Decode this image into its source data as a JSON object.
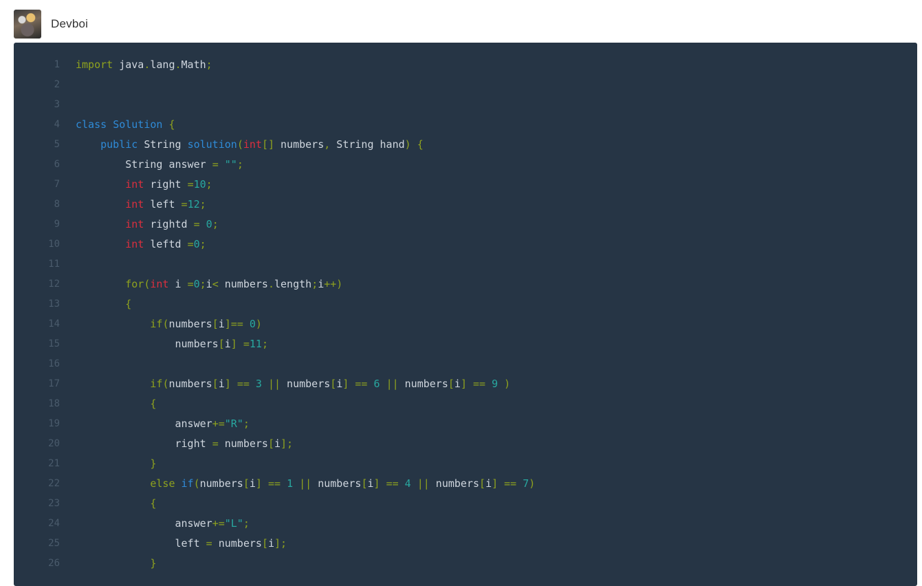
{
  "post": {
    "author": "Devboi"
  },
  "code": {
    "lines": [
      {
        "n": "1",
        "tokens": [
          [
            "kw",
            "import"
          ],
          [
            "id",
            " java"
          ],
          [
            "punc",
            "."
          ],
          [
            "id",
            "lang"
          ],
          [
            "punc",
            "."
          ],
          [
            "id",
            "Math"
          ],
          [
            "punc",
            ";"
          ]
        ]
      },
      {
        "n": "2",
        "tokens": []
      },
      {
        "n": "3",
        "tokens": []
      },
      {
        "n": "4",
        "tokens": [
          [
            "blue",
            "class"
          ],
          [
            "id",
            " "
          ],
          [
            "blue",
            "Solution"
          ],
          [
            "id",
            " "
          ],
          [
            "punc",
            "{"
          ]
        ]
      },
      {
        "n": "5",
        "tokens": [
          [
            "id",
            "    "
          ],
          [
            "blue",
            "public"
          ],
          [
            "id",
            " String "
          ],
          [
            "blue",
            "solution"
          ],
          [
            "punc",
            "("
          ],
          [
            "int",
            "int"
          ],
          [
            "punc",
            "[]"
          ],
          [
            "id",
            " numbers"
          ],
          [
            "punc",
            ","
          ],
          [
            "id",
            " String hand"
          ],
          [
            "punc",
            ")"
          ],
          [
            "id",
            " "
          ],
          [
            "punc",
            "{"
          ]
        ]
      },
      {
        "n": "6",
        "tokens": [
          [
            "id",
            "        String answer "
          ],
          [
            "punc",
            "="
          ],
          [
            "id",
            " "
          ],
          [
            "str",
            "\"\""
          ],
          [
            "punc",
            ";"
          ]
        ]
      },
      {
        "n": "7",
        "tokens": [
          [
            "id",
            "        "
          ],
          [
            "int",
            "int"
          ],
          [
            "id",
            " right "
          ],
          [
            "punc",
            "="
          ],
          [
            "num",
            "10"
          ],
          [
            "punc",
            ";"
          ]
        ]
      },
      {
        "n": "8",
        "tokens": [
          [
            "id",
            "        "
          ],
          [
            "int",
            "int"
          ],
          [
            "id",
            " left "
          ],
          [
            "punc",
            "="
          ],
          [
            "num",
            "12"
          ],
          [
            "punc",
            ";"
          ]
        ]
      },
      {
        "n": "9",
        "tokens": [
          [
            "id",
            "        "
          ],
          [
            "int",
            "int"
          ],
          [
            "id",
            " rightd "
          ],
          [
            "punc",
            "="
          ],
          [
            "id",
            " "
          ],
          [
            "num",
            "0"
          ],
          [
            "punc",
            ";"
          ]
        ]
      },
      {
        "n": "10",
        "tokens": [
          [
            "id",
            "        "
          ],
          [
            "int",
            "int"
          ],
          [
            "id",
            " leftd "
          ],
          [
            "punc",
            "="
          ],
          [
            "num",
            "0"
          ],
          [
            "punc",
            ";"
          ]
        ]
      },
      {
        "n": "11",
        "tokens": []
      },
      {
        "n": "12",
        "tokens": [
          [
            "id",
            "        "
          ],
          [
            "kw",
            "for"
          ],
          [
            "punc",
            "("
          ],
          [
            "int",
            "int"
          ],
          [
            "id",
            " i "
          ],
          [
            "punc",
            "="
          ],
          [
            "num",
            "0"
          ],
          [
            "punc",
            ";"
          ],
          [
            "id",
            "i"
          ],
          [
            "punc",
            "<"
          ],
          [
            "id",
            " numbers"
          ],
          [
            "punc",
            "."
          ],
          [
            "id",
            "length"
          ],
          [
            "punc",
            ";"
          ],
          [
            "id",
            "i"
          ],
          [
            "punc",
            "++)"
          ]
        ]
      },
      {
        "n": "13",
        "tokens": [
          [
            "id",
            "        "
          ],
          [
            "punc",
            "{"
          ]
        ]
      },
      {
        "n": "14",
        "tokens": [
          [
            "id",
            "            "
          ],
          [
            "kw",
            "if"
          ],
          [
            "punc",
            "("
          ],
          [
            "id",
            "numbers"
          ],
          [
            "punc",
            "["
          ],
          [
            "id",
            "i"
          ],
          [
            "punc",
            "]=="
          ],
          [
            "id",
            " "
          ],
          [
            "num",
            "0"
          ],
          [
            "punc",
            ")"
          ]
        ]
      },
      {
        "n": "15",
        "tokens": [
          [
            "id",
            "                numbers"
          ],
          [
            "punc",
            "["
          ],
          [
            "id",
            "i"
          ],
          [
            "punc",
            "]"
          ],
          [
            "id",
            " "
          ],
          [
            "punc",
            "="
          ],
          [
            "num",
            "11"
          ],
          [
            "punc",
            ";"
          ]
        ]
      },
      {
        "n": "16",
        "tokens": []
      },
      {
        "n": "17",
        "tokens": [
          [
            "id",
            "            "
          ],
          [
            "kw",
            "if"
          ],
          [
            "punc",
            "("
          ],
          [
            "id",
            "numbers"
          ],
          [
            "punc",
            "["
          ],
          [
            "id",
            "i"
          ],
          [
            "punc",
            "]"
          ],
          [
            "id",
            " "
          ],
          [
            "punc",
            "=="
          ],
          [
            "id",
            " "
          ],
          [
            "num",
            "3"
          ],
          [
            "id",
            " "
          ],
          [
            "punc",
            "||"
          ],
          [
            "id",
            " numbers"
          ],
          [
            "punc",
            "["
          ],
          [
            "id",
            "i"
          ],
          [
            "punc",
            "]"
          ],
          [
            "id",
            " "
          ],
          [
            "punc",
            "=="
          ],
          [
            "id",
            " "
          ],
          [
            "num",
            "6"
          ],
          [
            "id",
            " "
          ],
          [
            "punc",
            "||"
          ],
          [
            "id",
            " numbers"
          ],
          [
            "punc",
            "["
          ],
          [
            "id",
            "i"
          ],
          [
            "punc",
            "]"
          ],
          [
            "id",
            " "
          ],
          [
            "punc",
            "=="
          ],
          [
            "id",
            " "
          ],
          [
            "num",
            "9"
          ],
          [
            "id",
            " "
          ],
          [
            "punc",
            ")"
          ]
        ]
      },
      {
        "n": "18",
        "tokens": [
          [
            "id",
            "            "
          ],
          [
            "punc",
            "{"
          ]
        ]
      },
      {
        "n": "19",
        "tokens": [
          [
            "id",
            "                answer"
          ],
          [
            "punc",
            "+="
          ],
          [
            "str",
            "\"R\""
          ],
          [
            "punc",
            ";"
          ]
        ]
      },
      {
        "n": "20",
        "tokens": [
          [
            "id",
            "                right "
          ],
          [
            "punc",
            "="
          ],
          [
            "id",
            " numbers"
          ],
          [
            "punc",
            "["
          ],
          [
            "id",
            "i"
          ],
          [
            "punc",
            "];"
          ]
        ]
      },
      {
        "n": "21",
        "tokens": [
          [
            "id",
            "            "
          ],
          [
            "punc",
            "}"
          ]
        ]
      },
      {
        "n": "22",
        "tokens": [
          [
            "id",
            "            "
          ],
          [
            "kw",
            "else"
          ],
          [
            "id",
            " "
          ],
          [
            "blue",
            "if"
          ],
          [
            "punc",
            "("
          ],
          [
            "id",
            "numbers"
          ],
          [
            "punc",
            "["
          ],
          [
            "id",
            "i"
          ],
          [
            "punc",
            "]"
          ],
          [
            "id",
            " "
          ],
          [
            "punc",
            "=="
          ],
          [
            "id",
            " "
          ],
          [
            "num",
            "1"
          ],
          [
            "id",
            " "
          ],
          [
            "punc",
            "||"
          ],
          [
            "id",
            " numbers"
          ],
          [
            "punc",
            "["
          ],
          [
            "id",
            "i"
          ],
          [
            "punc",
            "]"
          ],
          [
            "id",
            " "
          ],
          [
            "punc",
            "=="
          ],
          [
            "id",
            " "
          ],
          [
            "num",
            "4"
          ],
          [
            "id",
            " "
          ],
          [
            "punc",
            "||"
          ],
          [
            "id",
            " numbers"
          ],
          [
            "punc",
            "["
          ],
          [
            "id",
            "i"
          ],
          [
            "punc",
            "]"
          ],
          [
            "id",
            " "
          ],
          [
            "punc",
            "=="
          ],
          [
            "id",
            " "
          ],
          [
            "num",
            "7"
          ],
          [
            "punc",
            ")"
          ]
        ]
      },
      {
        "n": "23",
        "tokens": [
          [
            "id",
            "            "
          ],
          [
            "punc",
            "{"
          ]
        ]
      },
      {
        "n": "24",
        "tokens": [
          [
            "id",
            "                answer"
          ],
          [
            "punc",
            "+="
          ],
          [
            "str",
            "\"L\""
          ],
          [
            "punc",
            ";"
          ]
        ]
      },
      {
        "n": "25",
        "tokens": [
          [
            "id",
            "                left "
          ],
          [
            "punc",
            "="
          ],
          [
            "id",
            " numbers"
          ],
          [
            "punc",
            "["
          ],
          [
            "id",
            "i"
          ],
          [
            "punc",
            "];"
          ]
        ]
      },
      {
        "n": "26",
        "tokens": [
          [
            "id",
            "            "
          ],
          [
            "punc",
            "}"
          ]
        ]
      }
    ]
  }
}
